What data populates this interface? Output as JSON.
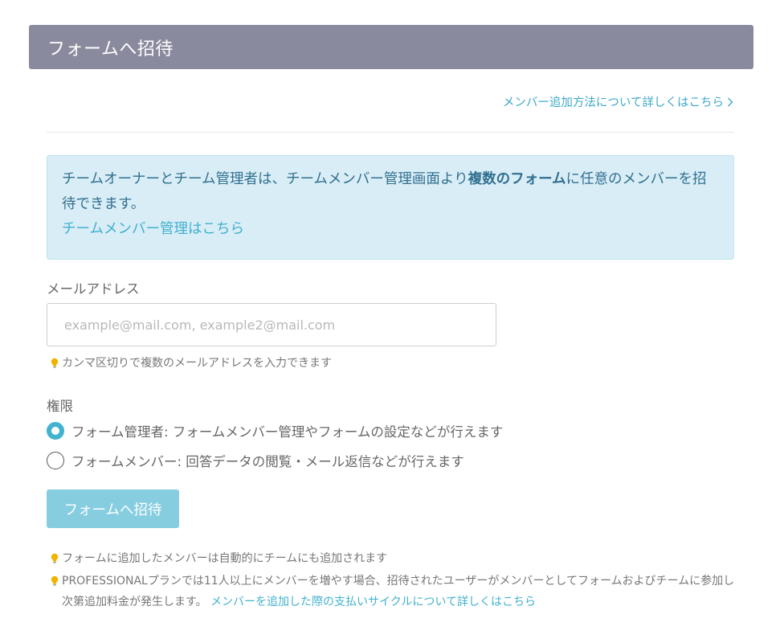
{
  "header": {
    "title": "フォームへ招待"
  },
  "help": {
    "link_label": "メンバー追加方法について詳しくはこちら"
  },
  "info": {
    "text_before": "チームオーナーとチーム管理者は、チームメンバー管理画面より",
    "text_bold": "複数のフォーム",
    "text_after": "に任意のメンバーを招待できます。",
    "link_label": "チームメンバー管理はこちら"
  },
  "email": {
    "label": "メールアドレス",
    "placeholder": "example@mail.com, example2@mail.com",
    "value": "",
    "hint": "カンマ区切りで複数のメールアドレスを入力できます"
  },
  "permission": {
    "label": "権限",
    "options": [
      {
        "label": "フォーム管理者: フォームメンバー管理やフォームの設定などが行えます",
        "selected": true
      },
      {
        "label": "フォームメンバー: 回答データの閲覧・メール返信などが行えます",
        "selected": false
      }
    ]
  },
  "submit": {
    "label": "フォームへ招待"
  },
  "notes": [
    {
      "text": "フォームに追加したメンバーは自動的にチームにも追加されます",
      "link": ""
    },
    {
      "text": "PROFESSIONALプランでは11人以上にメンバーを増やす場合、招待されたユーザーがメンバーとしてフォームおよびチームに参加し次第追加料金が発生します。 ",
      "link": "メンバーを追加した際の支払いサイクルについて詳しくはこちら"
    }
  ],
  "colors": {
    "header_bg": "#8a8a9e",
    "accent": "#41b3d1",
    "info_bg": "#d9edf7",
    "info_text": "#31708f",
    "button_bg": "#86cde0",
    "hint_bulb": "#f0b400"
  }
}
